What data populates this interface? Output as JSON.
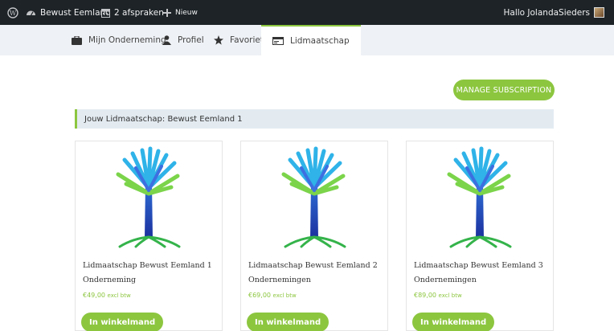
{
  "adminbar": {
    "site_name": "Bewust Eemland",
    "appointments": "2 afspraken",
    "new_label": "Nieuw",
    "greeting": "Hallo JolandaSieders"
  },
  "tabs": [
    {
      "label": "Mijn Onderneming",
      "icon": "briefcase-icon"
    },
    {
      "label": "Profiel",
      "icon": "user-icon"
    },
    {
      "label": "Favoriet",
      "icon": "star-icon"
    },
    {
      "label": "Lidmaatschap",
      "icon": "id-card-icon",
      "active": true
    }
  ],
  "manage_button": "MANAGE SUBSCRIPTION",
  "membership_banner": "Jouw Lidmaatschap: Bewust Eemland 1",
  "products": [
    {
      "title": "Lidmaatschap Bewust Eemland 1 Onderneming",
      "price": "€49,00",
      "price_suffix": "excl btw",
      "button": "In winkelmand"
    },
    {
      "title": "Lidmaatschap Bewust Eemland 2 Ondernemingen",
      "price": "€69,00",
      "price_suffix": "excl btw",
      "button": "In winkelmand"
    },
    {
      "title": "Lidmaatschap Bewust Eemland 3 Ondernemingen",
      "price": "€89,00",
      "price_suffix": "excl btw",
      "button": "In winkelmand"
    }
  ],
  "colors": {
    "accent": "#8cc63f",
    "adminbar": "#1d2327",
    "banner_bg": "#e3ebf1"
  }
}
